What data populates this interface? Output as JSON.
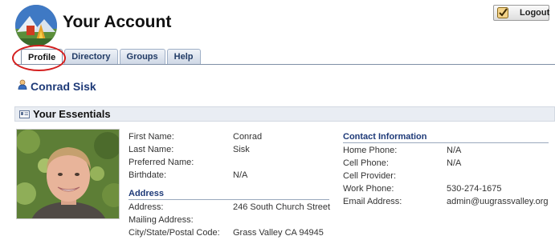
{
  "header": {
    "title": "Your Account",
    "logout_label": "Logout"
  },
  "tabs": [
    {
      "label": "Profile"
    },
    {
      "label": "Directory"
    },
    {
      "label": "Groups"
    },
    {
      "label": "Help"
    }
  ],
  "user": {
    "name": "Conrad Sisk"
  },
  "essentials": {
    "heading": "Your Essentials",
    "first_name": {
      "label": "First Name:",
      "value": "Conrad"
    },
    "last_name": {
      "label": "Last Name:",
      "value": "Sisk"
    },
    "preferred_name": {
      "label": "Preferred Name:",
      "value": ""
    },
    "birthdate": {
      "label": "Birthdate:",
      "value": "N/A"
    },
    "address_heading": "Address",
    "address": {
      "label": "Address:",
      "value": "246 South Church Street"
    },
    "mailing_address": {
      "label": "Mailing Address:",
      "value": ""
    },
    "city": {
      "label": "City/State/Postal Code:",
      "value": "Grass Valley CA 94945"
    }
  },
  "contact": {
    "heading": "Contact Information",
    "home_phone": {
      "label": "Home Phone:",
      "value": "N/A"
    },
    "cell_phone": {
      "label": "Cell Phone:",
      "value": "N/A"
    },
    "cell_provider": {
      "label": "Cell Provider:",
      "value": ""
    },
    "work_phone": {
      "label": "Work Phone:",
      "value": "530-274-1675"
    },
    "email": {
      "label": "Email Address:",
      "value": "admin@uugrassvalley.org"
    }
  },
  "colors": {
    "link_blue": "#1e3a78",
    "highlight_circle": "#d41f1f",
    "section_bg": "#e9edf3"
  }
}
